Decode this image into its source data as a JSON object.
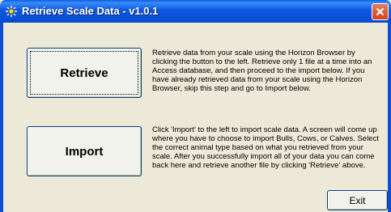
{
  "window": {
    "title": "Retrieve Scale Data - v1.0.1",
    "app_icon": "scale-app-icon",
    "close_icon": "close-icon"
  },
  "retrieve": {
    "button_label": "Retrieve",
    "description": "Retrieve data from your scale using the Horizon Browser by clicking the button to the left.  Retrieve only 1 file at a time into an Access database, and then proceed to the import below.  If you have already retrieved data from your scale using the Horizon Browser, skip this step and go to Import below."
  },
  "import": {
    "button_label": "Import",
    "description": "Click 'Import' to the left to import scale data.  A screen will come up where you have to choose to import Bulls, Cows, or Calves.  Select the correct animal type based on what you retrieved from your scale.  After you successfully import all of your data you can come back here and retrieve another file by clicking 'Retrieve' above."
  },
  "exit": {
    "button_label": "Exit"
  }
}
